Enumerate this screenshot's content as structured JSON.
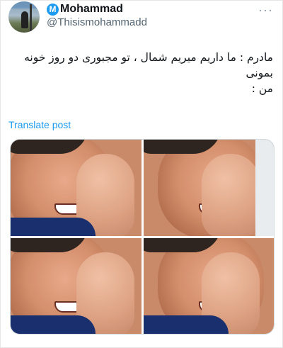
{
  "post": {
    "author": {
      "name": "Mohammad",
      "name_badge_letter": "M",
      "handle": "@Thisismohammadd",
      "avatar_icon": "profile-photo-icon"
    },
    "more_icon": "more-horizontal-icon",
    "more_glyph": "···",
    "text_lines": [
      "مادرم : ما داریم میریم شمال ، تو مجبوری دو روز خونه",
      "بمونی",
      "من :"
    ],
    "translate_label": "Translate post",
    "link_color": "#1d9bf0"
  }
}
